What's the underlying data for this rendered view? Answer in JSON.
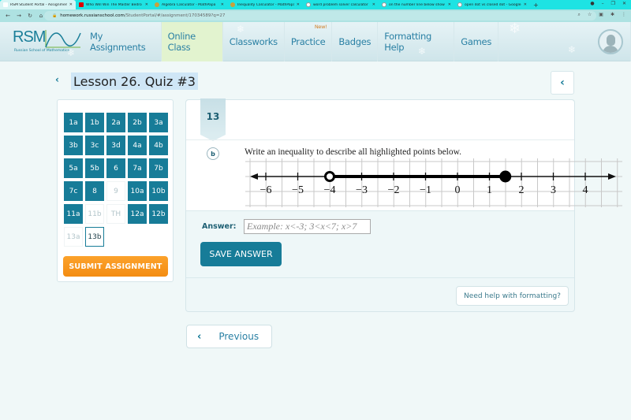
{
  "browser": {
    "tabs": [
      {
        "title": "RSM Student Portal - Assignment",
        "icon": "rsm-favicon",
        "active": true
      },
      {
        "title": "Who Will Win The Master Bedro",
        "icon": "youtube-favicon",
        "active": false
      },
      {
        "title": "Algebra Calculator - MathPapa",
        "icon": "mathpapa-favicon",
        "active": false
      },
      {
        "title": "Inequality Calculator - MathPapa",
        "icon": "mathpapa-favicon",
        "active": false
      },
      {
        "title": "word problem solver calculator",
        "icon": "google-favicon",
        "active": false
      },
      {
        "title": "on the number line below show",
        "icon": "google-favicon",
        "active": false
      },
      {
        "title": "open dot vs closed dot - Google",
        "icon": "google-favicon",
        "active": false
      }
    ],
    "new_tab": "+",
    "url_host": "homework.russianschool.com",
    "url_path": "/StudentPortal/#/assignment/17034589?q=27"
  },
  "header": {
    "logo_text": "RSM",
    "logo_subtitle": "Russian School of Mathematics",
    "nav": [
      {
        "label": "My Assignments",
        "active": false,
        "badge": ""
      },
      {
        "label": "Online Class",
        "active": true,
        "badge": ""
      },
      {
        "label": "Classworks",
        "active": false,
        "badge": ""
      },
      {
        "label": "Practice",
        "active": false,
        "badge": "New!"
      },
      {
        "label": "Badges",
        "active": false,
        "badge": ""
      },
      {
        "label": "Formatting Help",
        "active": false,
        "badge": ""
      },
      {
        "label": "Games",
        "active": false,
        "badge": ""
      }
    ]
  },
  "page": {
    "title": "Lesson 26. Quiz #3"
  },
  "question_nav": {
    "items": [
      {
        "label": "1a",
        "state": "done"
      },
      {
        "label": "1b",
        "state": "done"
      },
      {
        "label": "2a",
        "state": "done"
      },
      {
        "label": "2b",
        "state": "done"
      },
      {
        "label": "3a",
        "state": "done"
      },
      {
        "label": "3b",
        "state": "done"
      },
      {
        "label": "3c",
        "state": "done"
      },
      {
        "label": "3d",
        "state": "done"
      },
      {
        "label": "4a",
        "state": "done"
      },
      {
        "label": "4b",
        "state": "done"
      },
      {
        "label": "5a",
        "state": "done"
      },
      {
        "label": "5b",
        "state": "done"
      },
      {
        "label": "6",
        "state": "done"
      },
      {
        "label": "7a",
        "state": "done"
      },
      {
        "label": "7b",
        "state": "done"
      },
      {
        "label": "7c",
        "state": "done"
      },
      {
        "label": "8",
        "state": "done"
      },
      {
        "label": "9",
        "state": "todo"
      },
      {
        "label": "10a",
        "state": "done"
      },
      {
        "label": "10b",
        "state": "done"
      },
      {
        "label": "11a",
        "state": "done"
      },
      {
        "label": "11b",
        "state": "todo"
      },
      {
        "label": "TH",
        "state": "todo"
      },
      {
        "label": "12a",
        "state": "done"
      },
      {
        "label": "12b",
        "state": "done"
      },
      {
        "label": "13a",
        "state": "todo"
      },
      {
        "label": "13b",
        "state": "current"
      }
    ],
    "submit_label": "SUBMIT ASSIGNMENT"
  },
  "question": {
    "number": "13",
    "part": "b",
    "prompt": "Write an inequality to describe all highlighted points below.",
    "number_line": {
      "tick_labels": [
        "−6",
        "−5",
        "−4",
        "−3",
        "−2",
        "−1",
        "0",
        "1",
        "2",
        "3",
        "4"
      ],
      "min": -6,
      "max": 4,
      "left_arrow": true,
      "right_arrow": true,
      "segment_start": -4,
      "segment_start_closed": false,
      "segment_end": 1.5,
      "segment_end_closed": true
    },
    "answer_label": "Answer:",
    "answer_value": "",
    "answer_placeholder": "Example: x<-3; 3<x<7; x>7",
    "save_label": "SAVE ANSWER",
    "help_label": "Need help with formatting?"
  },
  "footer_nav": {
    "previous_label": "Previous"
  }
}
